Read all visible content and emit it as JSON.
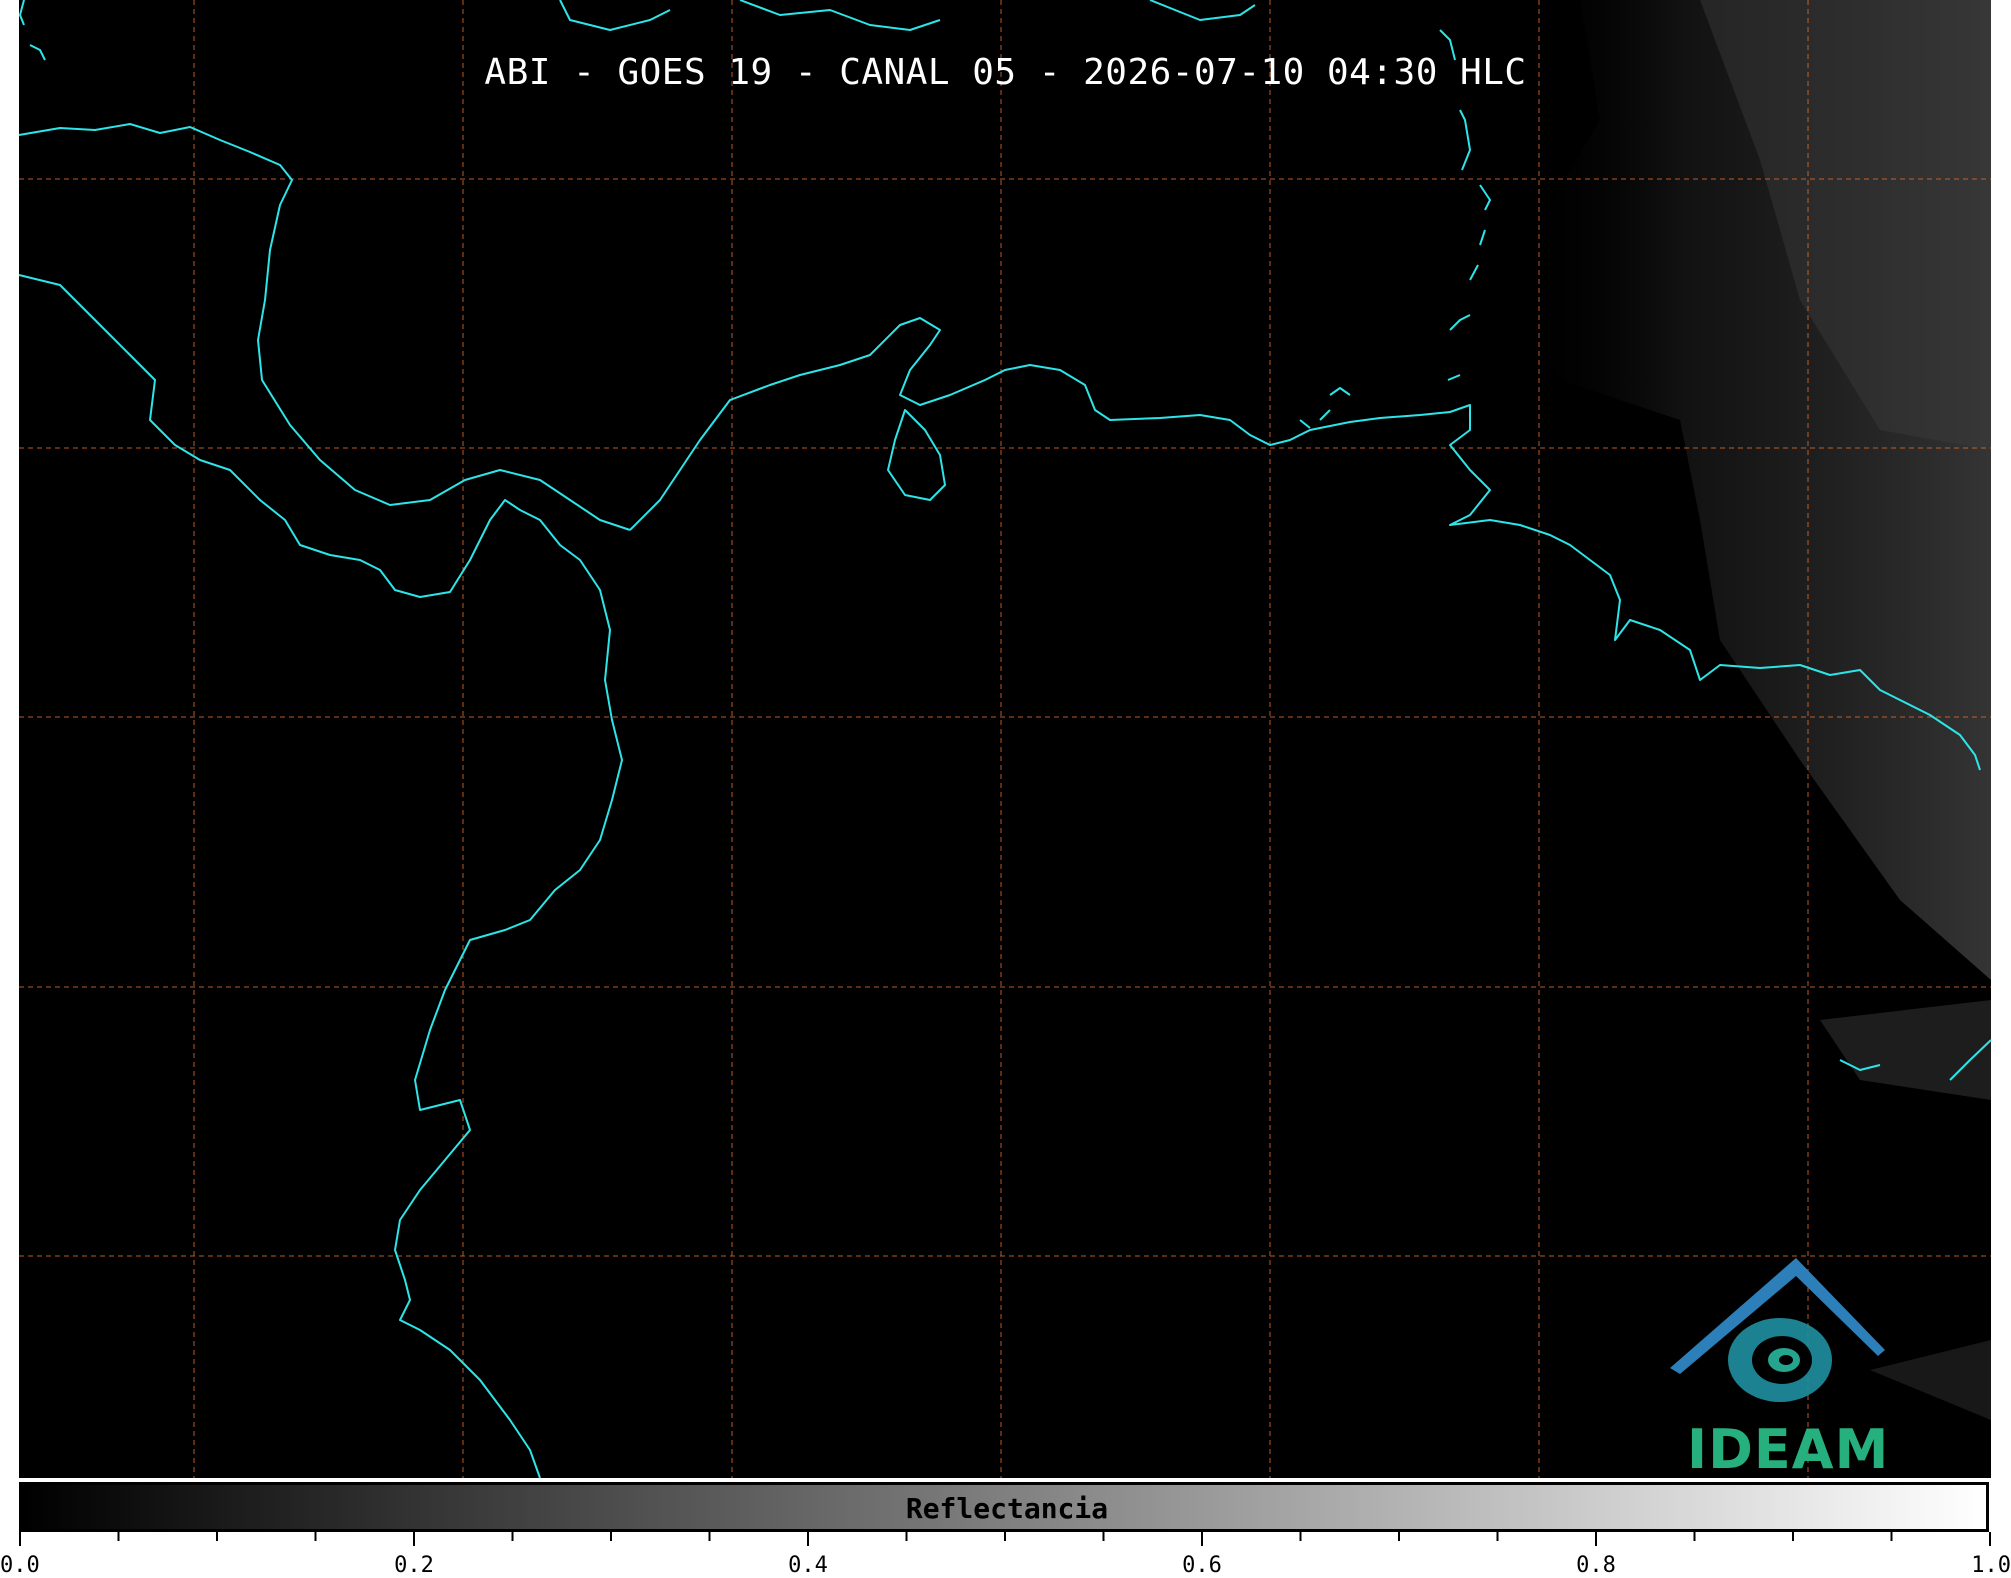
{
  "title": "ABI - GOES 19 - CANAL 05 - 2026-07-10 04:30 HLC",
  "logo": {
    "text": "IDEAM",
    "color": "#26b07e",
    "icon": "ideam-mountain-swirl-logo"
  },
  "map": {
    "background": "#000000",
    "coastline_color": "#2de5e8",
    "grid_color": "#d86a2a",
    "grid_style": "dashed"
  },
  "colorbar": {
    "label": "Reflectancia",
    "min": 0.0,
    "max": 1.0,
    "colormap": "grayscale",
    "tick_labels": [
      "0.0",
      "0.2",
      "0.4",
      "0.6",
      "0.8",
      "1.0"
    ]
  }
}
